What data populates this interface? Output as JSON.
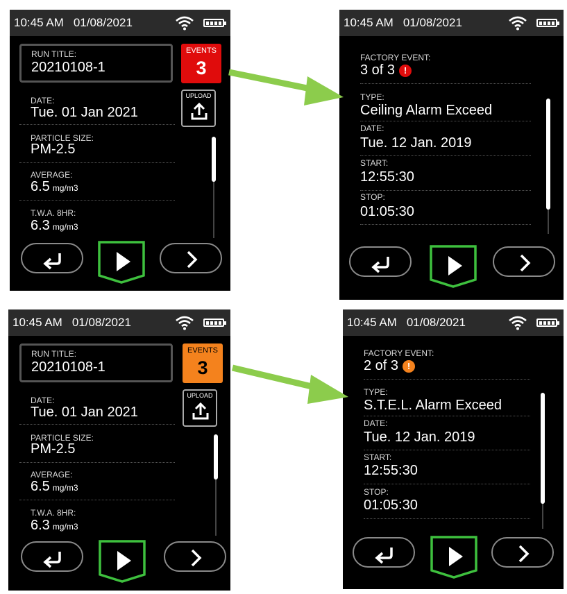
{
  "status_bar": {
    "time": "10:45 AM",
    "date": "01/08/2021"
  },
  "colors": {
    "alert_red": "#e00c0c",
    "alert_orange": "#f4821d",
    "play_green": "#3ec03e",
    "arrow_green": "#8ccc4c"
  },
  "run_summary": {
    "run_title_label": "RUN TITLE:",
    "run_title": "20210108-1",
    "date_label": "DATE:",
    "date": "Tue. 01 Jan 2021",
    "particle_size_label": "PARTICLE SIZE:",
    "particle_size": "PM-2.5",
    "average_label": "AVERAGE:",
    "average": "6.5",
    "twa_label": "T.W.A. 8HR:",
    "twa": "6.3",
    "unit": "mg/m3",
    "events_label": "EVENTS",
    "events_count": "3",
    "upload_label": "UPLOAD"
  },
  "event_detail": {
    "factory_event_label": "FACTORY EVENT:",
    "type_label": "TYPE:",
    "date_label": "DATE:",
    "start_label": "START:",
    "stop_label": "STOP:",
    "date": "Tue. 12 Jan. 2019",
    "start": "12:55:30",
    "stop": "01:05:30"
  },
  "panels": {
    "top": {
      "event_counter": "3 of 3",
      "event_type": "Ceiling Alarm Exceed",
      "alert_icon": "exclamation-red"
    },
    "bottom": {
      "event_counter": "2 of 3",
      "event_type": "S.T.E.L. Alarm Exceed",
      "alert_icon": "exclamation-orange"
    }
  },
  "icons": {
    "back": "return-arrow-icon",
    "play": "play-icon",
    "next": "chevron-right-icon",
    "upload": "upload-icon",
    "wifi": "wifi-icon",
    "battery": "battery-icon"
  }
}
